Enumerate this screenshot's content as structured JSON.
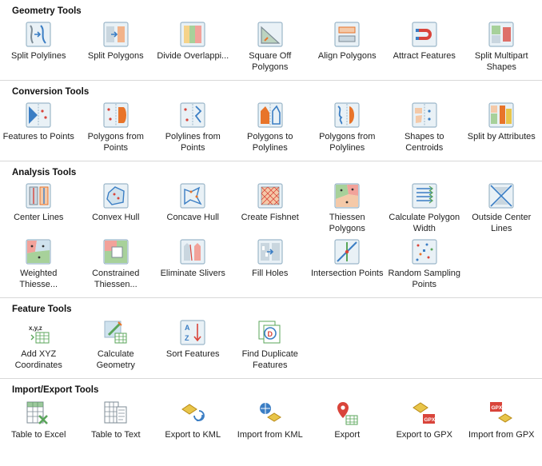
{
  "sections": [
    {
      "title": "Geometry Tools",
      "tools": [
        {
          "label": "Split Polylines",
          "icon": "split-polylines-icon"
        },
        {
          "label": "Split Polygons",
          "icon": "split-polygons-icon"
        },
        {
          "label": "Divide Overlappi...",
          "icon": "divide-overlapping-icon"
        },
        {
          "label": "Square Off Polygons",
          "icon": "square-off-polygons-icon"
        },
        {
          "label": "Align Polygons",
          "icon": "align-polygons-icon"
        },
        {
          "label": "Attract Features",
          "icon": "attract-features-icon"
        },
        {
          "label": "Split Multipart Shapes",
          "icon": "split-multipart-icon"
        }
      ]
    },
    {
      "title": "Conversion Tools",
      "tools": [
        {
          "label": "Features to Points",
          "icon": "features-to-points-icon"
        },
        {
          "label": "Polygons from Points",
          "icon": "polygons-from-points-icon"
        },
        {
          "label": "Polylines from Points",
          "icon": "polylines-from-points-icon"
        },
        {
          "label": "Polygons to Polylines",
          "icon": "polygons-to-polylines-icon"
        },
        {
          "label": "Polygons from Polylines",
          "icon": "polygons-from-polylines-icon"
        },
        {
          "label": "Shapes to Centroids",
          "icon": "shapes-to-centroids-icon"
        },
        {
          "label": "Split by Attributes",
          "icon": "split-by-attributes-icon"
        }
      ]
    },
    {
      "title": "Analysis Tools",
      "tools": [
        {
          "label": "Center Lines",
          "icon": "center-lines-icon"
        },
        {
          "label": "Convex Hull",
          "icon": "convex-hull-icon"
        },
        {
          "label": "Concave Hull",
          "icon": "concave-hull-icon"
        },
        {
          "label": "Create Fishnet",
          "icon": "create-fishnet-icon"
        },
        {
          "label": "Thiessen Polygons",
          "icon": "thiessen-polygons-icon"
        },
        {
          "label": "Calculate Polygon Width",
          "icon": "calculate-polygon-width-icon"
        },
        {
          "label": "Outside Center Lines",
          "icon": "outside-center-lines-icon"
        },
        {
          "label": "Weighted Thiesse...",
          "icon": "weighted-thiessen-icon"
        },
        {
          "label": "Constrained Thiessen...",
          "icon": "constrained-thiessen-icon"
        },
        {
          "label": "Eliminate Slivers",
          "icon": "eliminate-slivers-icon"
        },
        {
          "label": "Fill Holes",
          "icon": "fill-holes-icon"
        },
        {
          "label": "Intersection Points",
          "icon": "intersection-points-icon"
        },
        {
          "label": "Random Sampling Points",
          "icon": "random-sampling-points-icon"
        }
      ]
    },
    {
      "title": "Feature Tools",
      "tools": [
        {
          "label": "Add XYZ Coordinates",
          "icon": "add-xyz-coordinates-icon"
        },
        {
          "label": "Calculate Geometry",
          "icon": "calculate-geometry-icon"
        },
        {
          "label": "Sort Features",
          "icon": "sort-features-icon"
        },
        {
          "label": "Find Duplicate Features",
          "icon": "find-duplicate-features-icon"
        }
      ]
    },
    {
      "title": "Import/Export Tools",
      "tools": [
        {
          "label": "Table to Excel",
          "icon": "table-to-excel-icon"
        },
        {
          "label": "Table to Text",
          "icon": "table-to-text-icon"
        },
        {
          "label": "Export to KML",
          "icon": "export-to-kml-icon"
        },
        {
          "label": "Import from KML",
          "icon": "import-from-kml-icon"
        },
        {
          "label": "Export",
          "icon": "export-icon"
        },
        {
          "label": "Export to GPX",
          "icon": "export-to-gpx-icon"
        },
        {
          "label": "Import from GPX",
          "icon": "import-from-gpx-icon"
        }
      ]
    }
  ],
  "colors": {
    "panel_border": "#9cb7c9",
    "panel_fill": "#e9f1f6",
    "accent_orange": "#e8742a",
    "accent_blue": "#3b7ec4",
    "accent_green": "#5aa55a",
    "accent_red": "#d9443a",
    "accent_yellow": "#e8c54a"
  }
}
